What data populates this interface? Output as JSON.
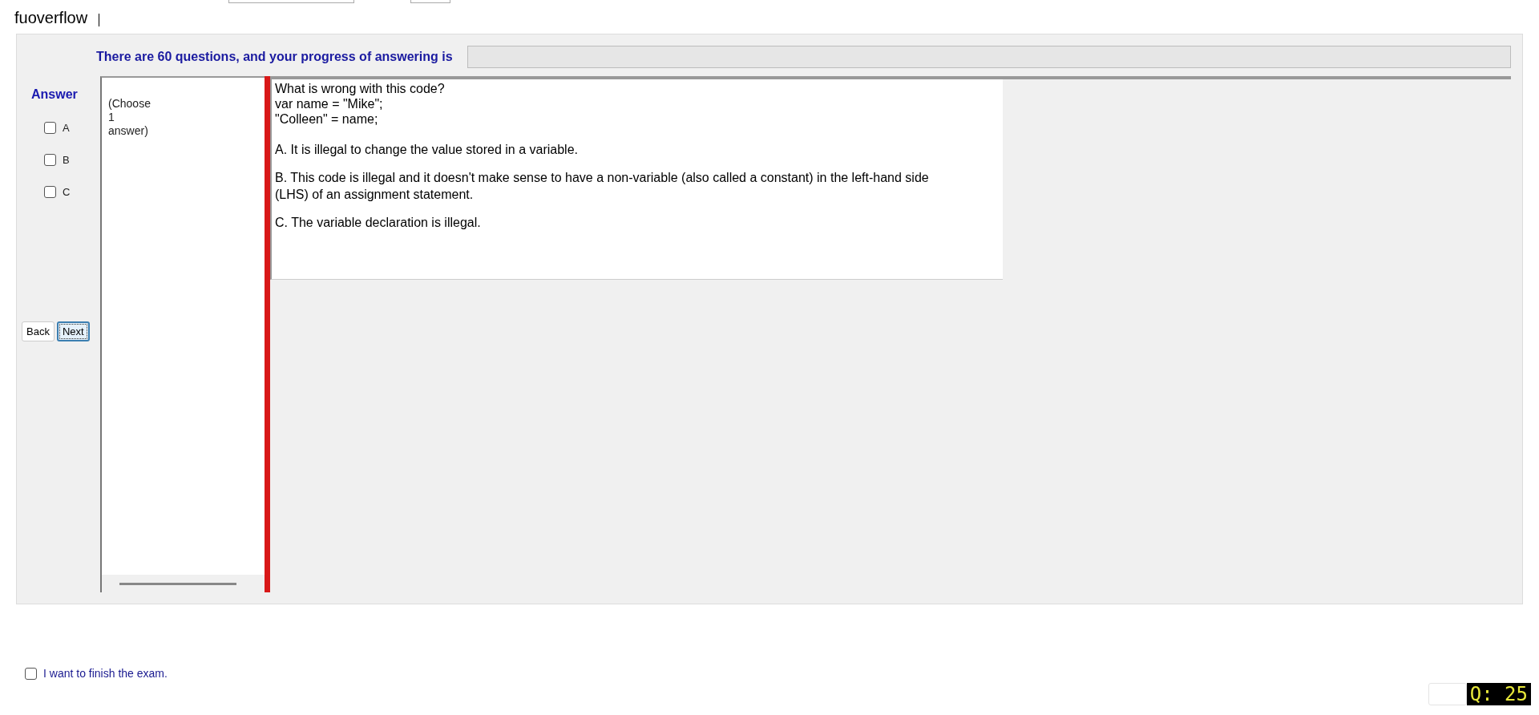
{
  "header": {
    "username": "fuoverflow"
  },
  "progress": {
    "label": "There are 60 questions, and your progress of answering is",
    "level": 0
  },
  "answer_panel": {
    "title": "Answer",
    "options": [
      {
        "label": "A",
        "checked": false
      },
      {
        "label": "B",
        "checked": false
      },
      {
        "label": "C",
        "checked": false
      }
    ]
  },
  "buttons": [
    {
      "label": "Back",
      "focused": false
    },
    {
      "label": "Next",
      "focused": true
    }
  ],
  "instruction": [
    "(Choose",
    "1",
    "answer)"
  ],
  "question": {
    "lines": [
      "What is wrong with this code?",
      "var name = \"Mike\";",
      "\"Colleen\" = name;"
    ],
    "choices": [
      "A.  It is illegal to change the value stored in a variable.",
      "B.  This code is illegal and it doesn't make sense to have a non-variable (also called a constant) in the left-hand side (LHS) of an assignment statement.",
      "C.  The variable declaration is illegal."
    ]
  },
  "finish": {
    "label": "I want to finish the exam.",
    "checked": false
  },
  "question_number": "Q: 25"
}
